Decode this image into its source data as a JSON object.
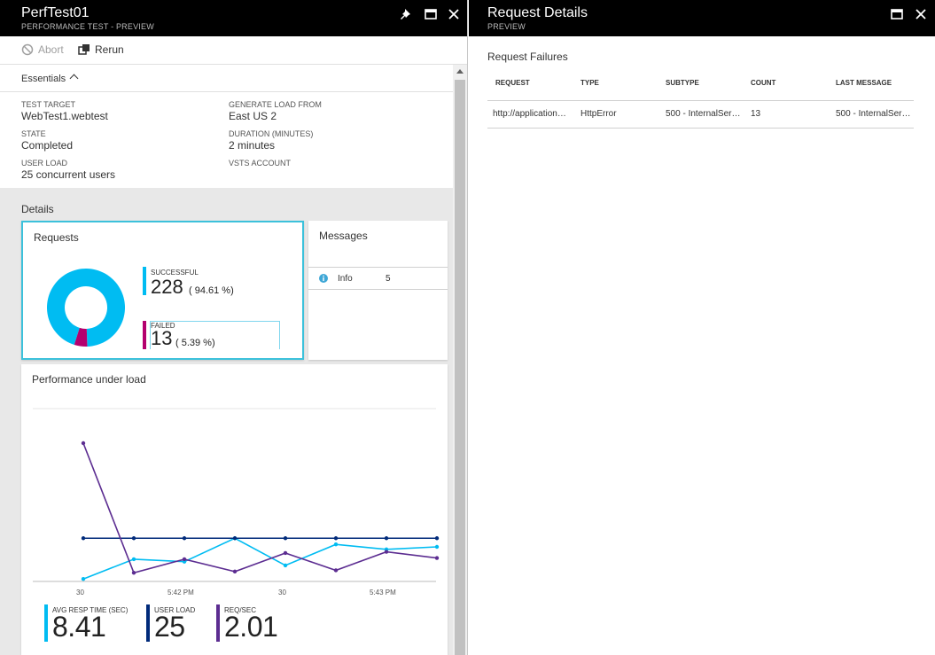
{
  "left_blade": {
    "title": "PerfTest01",
    "subtitle": "PERFORMANCE TEST - PREVIEW",
    "icons": [
      "pin-icon",
      "maximize-icon",
      "close-icon"
    ]
  },
  "toolbar": {
    "abort_label": "Abort",
    "rerun_label": "Rerun"
  },
  "essentials": {
    "label": "Essentials",
    "fields": [
      {
        "key": "TEST TARGET",
        "value": "WebTest1.webtest"
      },
      {
        "key": "STATE",
        "value": "Completed"
      },
      {
        "key": "USER LOAD",
        "value": "25 concurrent users"
      },
      {
        "key": "GENERATE LOAD FROM",
        "value": "East US 2"
      },
      {
        "key": "DURATION (MINUTES)",
        "value": "2 minutes"
      },
      {
        "key": "VSTS ACCOUNT",
        "value": ""
      }
    ]
  },
  "details": {
    "label": "Details",
    "requests": {
      "title": "Requests",
      "successful_label": "SUCCESSFUL",
      "successful_count": "228",
      "successful_pct": "( 94.61 %)",
      "failed_label": "FAILED",
      "failed_count": "13",
      "failed_pct": "( 5.39 %)",
      "successful_color": "#00bcf2",
      "failed_color": "#b4006e",
      "successful_fraction": 0.9461
    },
    "messages": {
      "title": "Messages",
      "rows": [
        {
          "level": "Info",
          "count": "5"
        }
      ]
    },
    "performance": {
      "title": "Performance under load",
      "x_ticks": [
        "30",
        "5:42 PM",
        "30",
        "5:43 PM"
      ],
      "kpis": [
        {
          "key": "AVG RESP TIME (SEC)",
          "value": "8.41",
          "color": "#00bcf2"
        },
        {
          "key": "USER LOAD",
          "value": "25",
          "color": "#002a7a"
        },
        {
          "key": "REQ/SEC",
          "value": "2.01",
          "color": "#5c2d91"
        }
      ]
    }
  },
  "right_blade": {
    "title": "Request Details",
    "subtitle": "PREVIEW",
    "icons": [
      "maximize-icon",
      "close-icon"
    ],
    "section_title": "Request Failures",
    "columns": [
      "REQUEST",
      "TYPE",
      "SUBTYPE",
      "COUNT",
      "LAST MESSAGE"
    ],
    "rows": [
      [
        "http://application…",
        "HttpError",
        "500 - InternalSer…",
        "13",
        "500 - InternalSer…"
      ]
    ]
  },
  "chart_data": {
    "type": "line",
    "title": "Performance under load",
    "x": [
      "5:41:30 PM",
      "5:41:45 PM",
      "5:42:00 PM",
      "5:42:15 PM",
      "5:42:30 PM",
      "5:42:45 PM",
      "5:43:00 PM",
      "5:43:15 PM"
    ],
    "x_tick_labels": [
      "30",
      "5:42 PM",
      "30",
      "5:43 PM"
    ],
    "series": [
      {
        "name": "AVG RESP TIME (SEC)",
        "color": "#00bcf2",
        "values": [
          0.2,
          1.8,
          1.6,
          3.5,
          1.3,
          3.0,
          2.6,
          2.8
        ]
      },
      {
        "name": "USER LOAD",
        "color": "#002a7a",
        "values": [
          3.5,
          3.5,
          3.5,
          3.5,
          3.5,
          3.5,
          3.5,
          3.5
        ]
      },
      {
        "name": "REQ/SEC",
        "color": "#5c2d91",
        "values": [
          11.2,
          0.7,
          1.8,
          0.8,
          2.3,
          0.9,
          2.4,
          1.9
        ]
      }
    ],
    "ylim": [
      0,
      14
    ],
    "grid": true
  }
}
